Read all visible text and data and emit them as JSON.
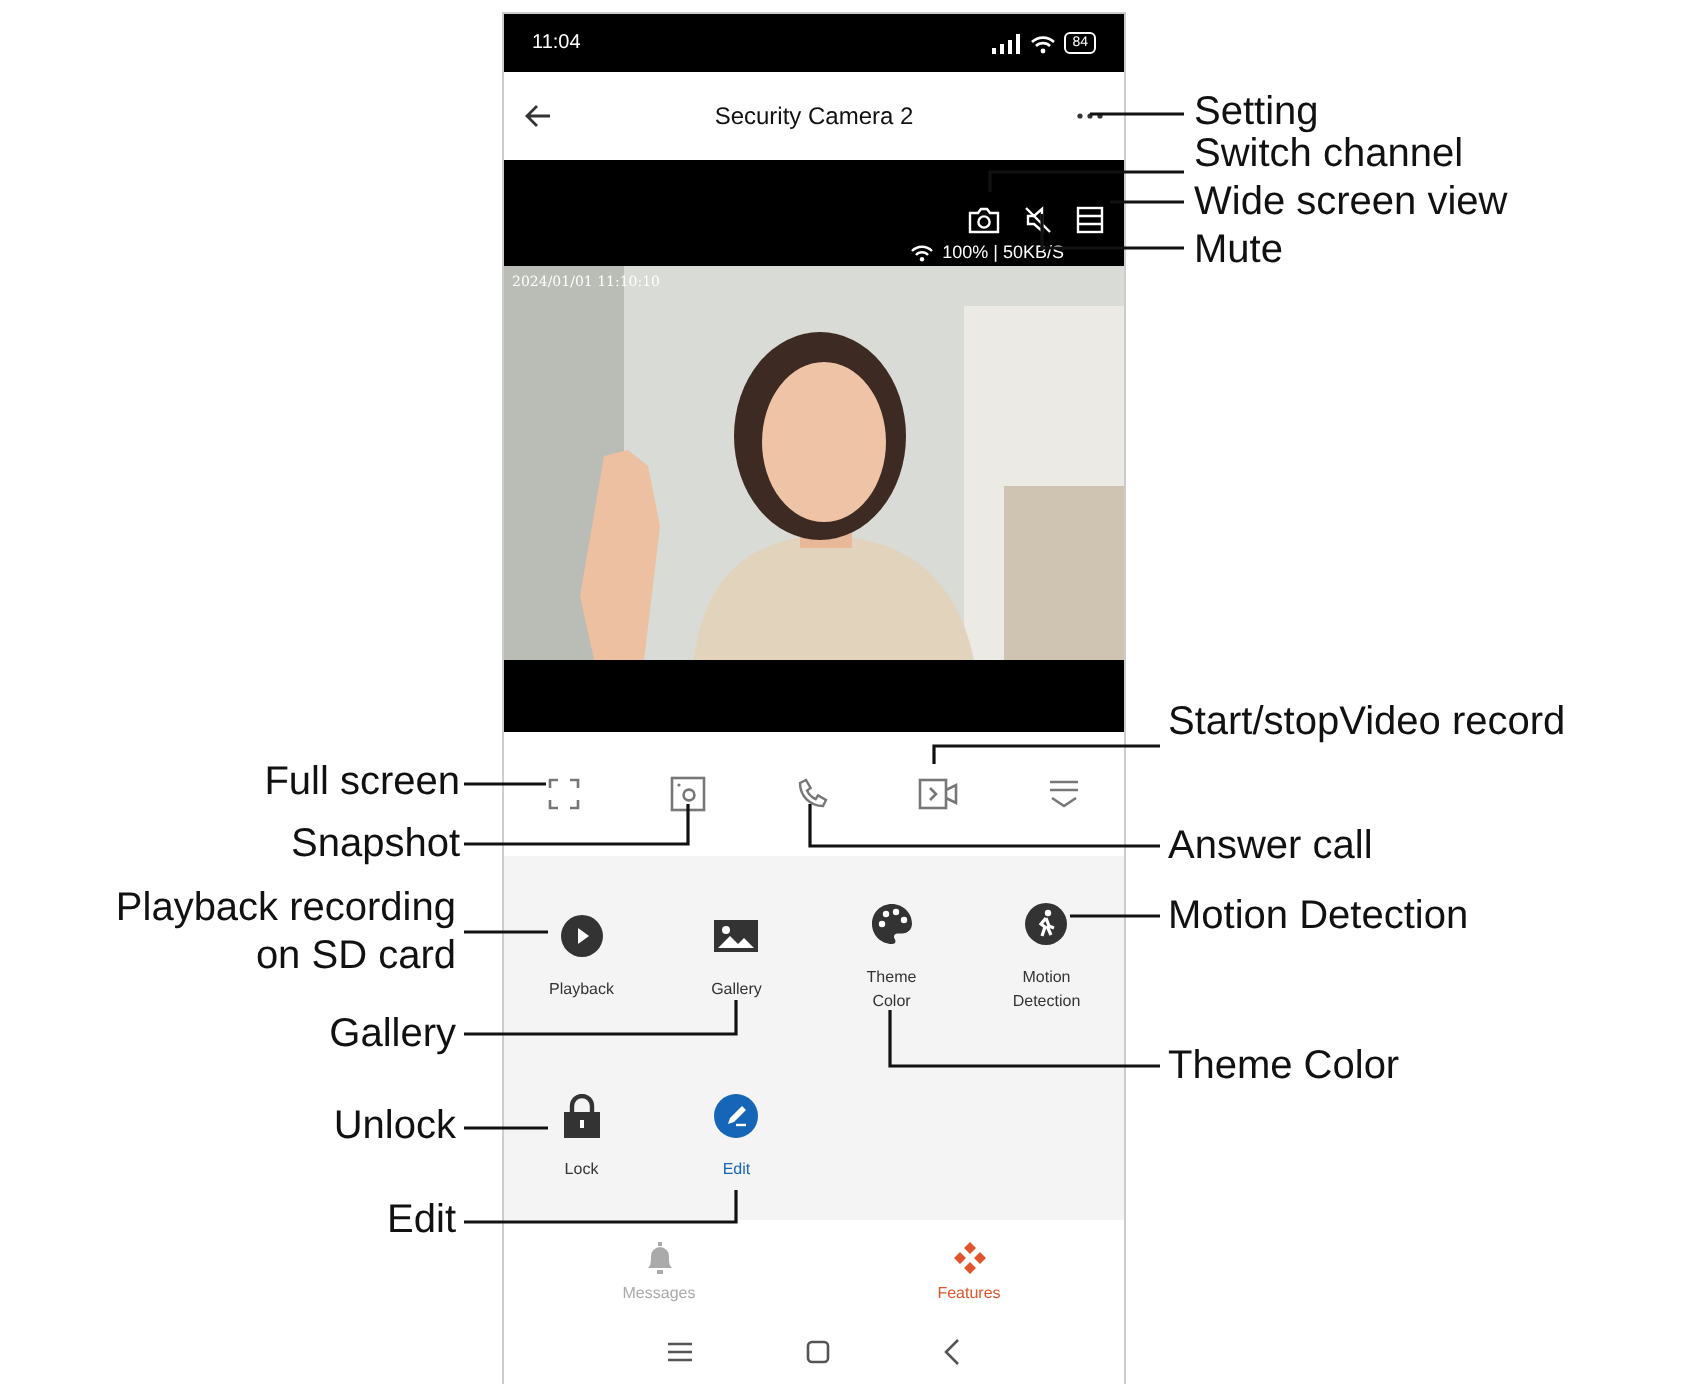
{
  "status_bar": {
    "time": "11:04",
    "battery": "84"
  },
  "header": {
    "title": "Security Camera 2"
  },
  "video": {
    "network": "100% | 50KB/S",
    "timestamp": "2024/01/01 11:10:10"
  },
  "features": [
    {
      "label": "Playback",
      "kind": "playback",
      "selected": false
    },
    {
      "label": "Gallery",
      "kind": "gallery",
      "selected": false
    },
    {
      "label": "Theme\nColor",
      "kind": "theme",
      "selected": false
    },
    {
      "label": "Motion\nDetection",
      "kind": "motion",
      "selected": false
    },
    {
      "label": "Lock",
      "kind": "lock",
      "selected": false
    },
    {
      "label": "Edit",
      "kind": "edit",
      "selected": true
    }
  ],
  "tabs": [
    {
      "label": "Messages",
      "kind": "bell",
      "selected": false
    },
    {
      "label": "Features",
      "kind": "diamonds",
      "selected": true
    }
  ],
  "annotations": [
    {
      "text": "Setting"
    },
    {
      "text": "Switch channel"
    },
    {
      "text": "Wide screen view"
    },
    {
      "text": "Mute"
    },
    {
      "text": "Start/stopVideo record"
    },
    {
      "text": "Full screen"
    },
    {
      "text": "Snapshot"
    },
    {
      "text": "Answer call"
    },
    {
      "text": "Playback recording\non SD card"
    },
    {
      "text": "Motion Detection"
    },
    {
      "text": "Gallery"
    },
    {
      "text": "Theme Color"
    },
    {
      "text": "Unlock"
    },
    {
      "text": "Edit"
    }
  ]
}
